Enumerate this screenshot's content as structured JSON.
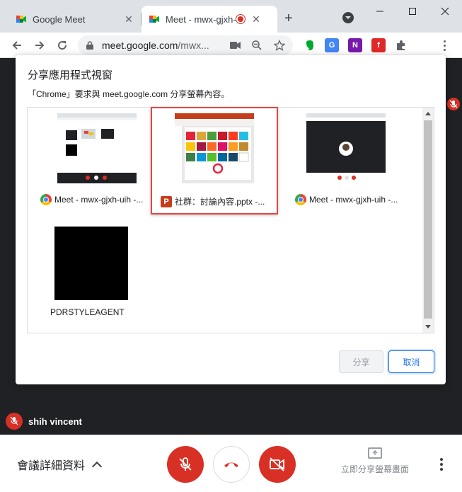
{
  "browser": {
    "tabs": [
      {
        "label": "Google Meet",
        "icon": "google-meet-icon",
        "active": false
      },
      {
        "label": "Meet - mwx-gjxh-uih",
        "icon": "google-meet-icon",
        "active": true,
        "recording": true
      }
    ],
    "window_controls": [
      "minimize",
      "maximize",
      "close"
    ],
    "url_host": "meet.google.com",
    "url_rest": "/mwx...",
    "extensions": [
      "evernote-icon",
      "google-translate-icon",
      "onenote-icon",
      "flipboard-icon",
      "extensions-puzzle-icon"
    ]
  },
  "dialog": {
    "title": "分享應用程式視窗",
    "subtitle": "「Chrome」要求與 meet.google.com 分享螢幕內容。",
    "sources": [
      {
        "label": "Meet - mwx-gjxh-uih -...",
        "icon": "chrome-icon",
        "selected": false
      },
      {
        "label": "社群：討論內容.pptx -...",
        "icon": "powerpoint-icon",
        "selected": true
      },
      {
        "label": "Meet - mwx-gjxh-uih -...",
        "icon": "chrome-icon",
        "selected": false
      },
      {
        "label": "PDRSTYLEAGENT",
        "icon": "",
        "selected": false
      }
    ],
    "share_label": "分享",
    "cancel_label": "取消"
  },
  "meeting": {
    "participant_name": "shih vincent",
    "details_label": "會議詳細資料",
    "present_label": "立即分享螢幕畫面",
    "colors": {
      "red": "#d93025",
      "dark": "#202124",
      "accent": "#1a73e8",
      "selection": "#e04844"
    }
  }
}
